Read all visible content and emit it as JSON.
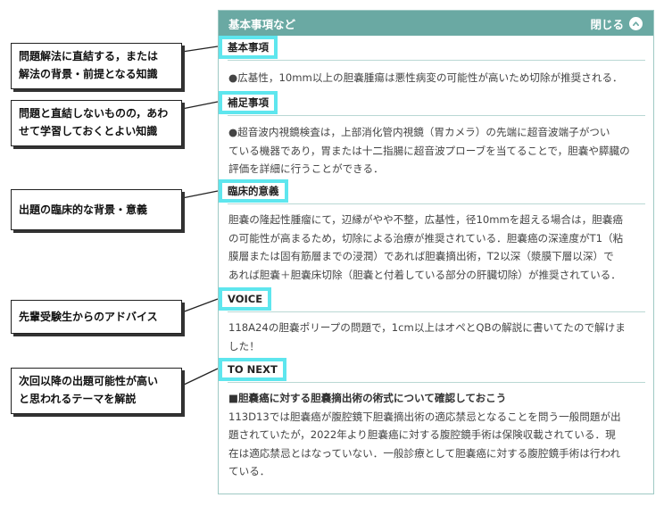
{
  "header": {
    "title": "基本事項など",
    "close_label": "閉じる"
  },
  "sections": {
    "basic": {
      "label": "基本事項",
      "lines": [
        "●広基性，10mm以上の胆嚢腫瘍は悪性病変の可能性が高いため切除が推奨される．"
      ]
    },
    "supplement": {
      "label": "補足事項",
      "lines": [
        "●超音波内視鏡検査は，上部消化管内視鏡（胃カメラ）の先端に超音波端子がつい",
        "ている機器であり，胃または十二指腸に超音波プローブを当てることで，胆嚢や膵臓の",
        "評価を詳細に行うことができる．"
      ]
    },
    "clinical": {
      "label": "臨床的意義",
      "lines": [
        "胆嚢の隆起性腫瘤にて，辺縁がやや不整，広基性，径10mmを超える場合は，胆嚢癌",
        "の可能性が高まるため，切除による治療が推奨されている．胆嚢癌の深達度がT1（粘",
        "膜層または固有筋層までの浸潤）であれば胆嚢摘出術，T2以深（漿膜下層以深）で",
        "あれば胆嚢＋胆嚢床切除（胆嚢と付着している部分の肝臓切除）が推奨されている．"
      ]
    },
    "voice": {
      "label": "VOICE",
      "lines": [
        "118A24の胆嚢ポリープの問題で，1cm以上はオペとQBの解説に書いてたので解けま",
        "した！"
      ]
    },
    "tonext": {
      "label": "TO NEXT",
      "headline": "■胆嚢癌に対する胆嚢摘出術の術式について確認しておこう",
      "lines": [
        "113D13では胆嚢癌が腹腔鏡下胆嚢摘出術の適応禁忌となることを問う一般問題が出",
        "題されていたが，2022年より胆嚢癌に対する腹腔鏡手術は保険収載されている．現",
        "在は適応禁忌とはなっていない．一般診療として胆嚢癌に対する腹腔鏡手術は行われ",
        "ている．"
      ]
    }
  },
  "callouts": [
    {
      "line1": "問題解法に直結する，または",
      "line2": "解法の背景・前提となる知識"
    },
    {
      "line1": "問題と直結しないものの，あわ",
      "line2": "せて学習しておくとよい知識"
    },
    {
      "line1": "出題の臨床的な背景・意義",
      "line2": ""
    },
    {
      "line1": "先輩受験生からのアドバイス",
      "line2": ""
    },
    {
      "line1": "次回以降の出題可能性が高い",
      "line2": "と思われるテーマを解説"
    }
  ],
  "colors": {
    "header_bg": "#6aa9a3",
    "label_highlight": "#5ee6ee",
    "rule": "#b9d8d4"
  },
  "icons": {
    "close": "chevron-up-icon"
  }
}
